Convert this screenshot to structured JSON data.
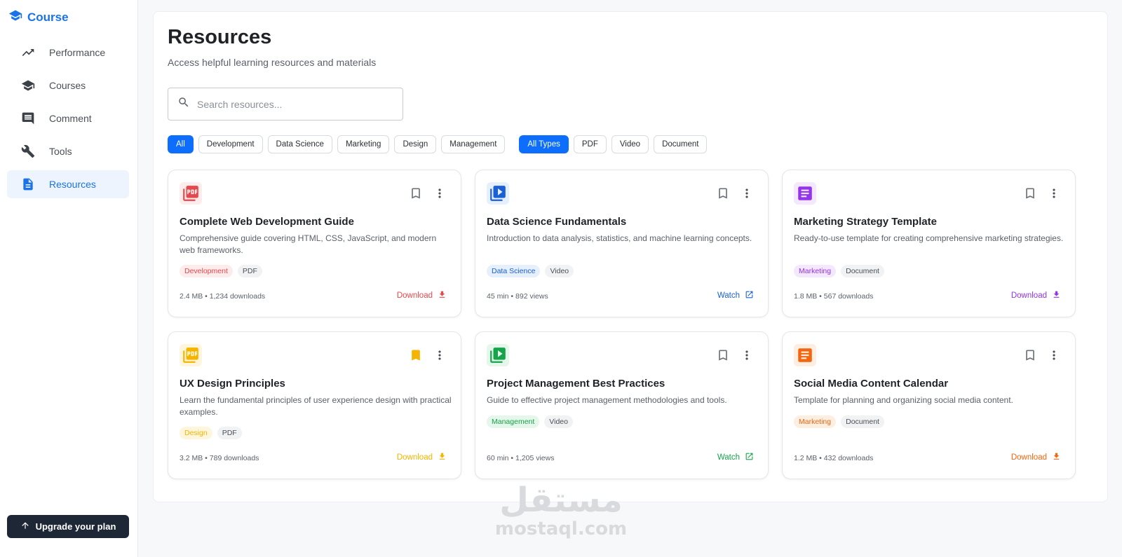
{
  "sidebar": {
    "brand": {
      "label": "Course",
      "icon": "graduation-cap-icon"
    },
    "items": [
      {
        "label": "Performance",
        "icon": "trending-icon",
        "active": false
      },
      {
        "label": "Courses",
        "icon": "school-icon",
        "active": false
      },
      {
        "label": "Comment",
        "icon": "comment-icon",
        "active": false
      },
      {
        "label": "Tools",
        "icon": "wrench-icon",
        "active": false
      },
      {
        "label": "Resources",
        "icon": "document-icon",
        "active": true
      }
    ],
    "upgrade_label": "Upgrade your plan"
  },
  "main": {
    "title": "Resources",
    "subtitle": "Access helpful learning resources and materials",
    "search": {
      "placeholder": "Search resources...",
      "value": ""
    },
    "category_filters": [
      "All",
      "Development",
      "Data Science",
      "Marketing",
      "Design",
      "Management"
    ],
    "active_category": "All",
    "type_filters": [
      "All Types",
      "PDF",
      "Video",
      "Document"
    ],
    "active_type": "All Types",
    "resources": [
      {
        "title": "Complete Web Development Guide",
        "description": "Comprehensive guide covering HTML, CSS, JavaScript, and modern web frameworks.",
        "category": "Development",
        "type": "PDF",
        "meta": "2.4 MB • 1,234 downloads",
        "action": "Download",
        "icon": "pdf-icon",
        "color": "#e5484d",
        "tint": "#fdecec",
        "bookmarked": false
      },
      {
        "title": "Data Science Fundamentals",
        "description": "Introduction to data analysis, statistics, and machine learning concepts.",
        "category": "Data Science",
        "type": "Video",
        "meta": "45 min • 892 views",
        "action": "Watch",
        "icon": "video-library-icon",
        "color": "#1a5fd6",
        "tint": "#e6effc",
        "bookmarked": false
      },
      {
        "title": "Marketing Strategy Template",
        "description": "Ready-to-use template for creating comprehensive marketing strategies.",
        "category": "Marketing",
        "type": "Document",
        "meta": "1.8 MB • 567 downloads",
        "action": "Download",
        "icon": "article-icon",
        "color": "#9333ea",
        "tint": "#f3e8fd",
        "bookmarked": false
      },
      {
        "title": "UX Design Principles",
        "description": "Learn the fundamental principles of user experience design with practical examples.",
        "category": "Design",
        "type": "PDF",
        "meta": "3.2 MB • 789 downloads",
        "action": "Download",
        "icon": "pdf-icon",
        "color": "#f5b400",
        "tint": "#fef6dc",
        "bookmarked": true
      },
      {
        "title": "Project Management Best Practices",
        "description": "Guide to effective project management methodologies and tools.",
        "category": "Management",
        "type": "Video",
        "meta": "60 min • 1,205 views",
        "action": "Watch",
        "icon": "video-library-icon",
        "color": "#16a34a",
        "tint": "#e5f6ea",
        "bookmarked": false
      },
      {
        "title": "Social Media Content Calendar",
        "description": "Template for planning and organizing social media content.",
        "category": "Marketing",
        "type": "Document",
        "meta": "1.2 MB • 432 downloads",
        "action": "Download",
        "icon": "article-icon",
        "color": "#f0670f",
        "tint": "#fdeee2",
        "bookmarked": false
      }
    ]
  },
  "watermark": {
    "arabic": "مستقل",
    "latin": "mostaql.com"
  }
}
